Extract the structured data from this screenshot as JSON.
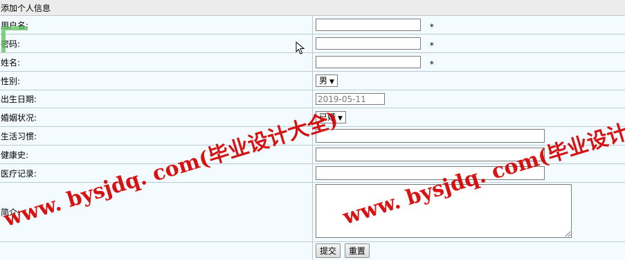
{
  "form": {
    "title": "添加个人信息",
    "fields": {
      "username": {
        "label": "用户名:",
        "value": "",
        "required_mark": "*"
      },
      "password": {
        "label": "密码:",
        "value": "",
        "required_mark": "*"
      },
      "name": {
        "label": "姓名:",
        "value": "",
        "required_mark": "*"
      },
      "gender": {
        "label": "性别:",
        "selected": "男"
      },
      "birthdate": {
        "label": "出生日期:",
        "value": "2019-05-11"
      },
      "marital": {
        "label": "婚姻状况:",
        "selected": "已婚"
      },
      "habits": {
        "label": "生活习惯:",
        "value": ""
      },
      "health_history": {
        "label": "健康史:",
        "value": ""
      },
      "medical_record": {
        "label": "医疗记录:",
        "value": ""
      },
      "intro": {
        "label": "简介:",
        "value": ""
      }
    },
    "buttons": {
      "submit": "提交",
      "reset": "重置"
    }
  },
  "watermark": {
    "text": "www. bysjdq. com(毕业设计大全)",
    "color": "#d40000"
  }
}
